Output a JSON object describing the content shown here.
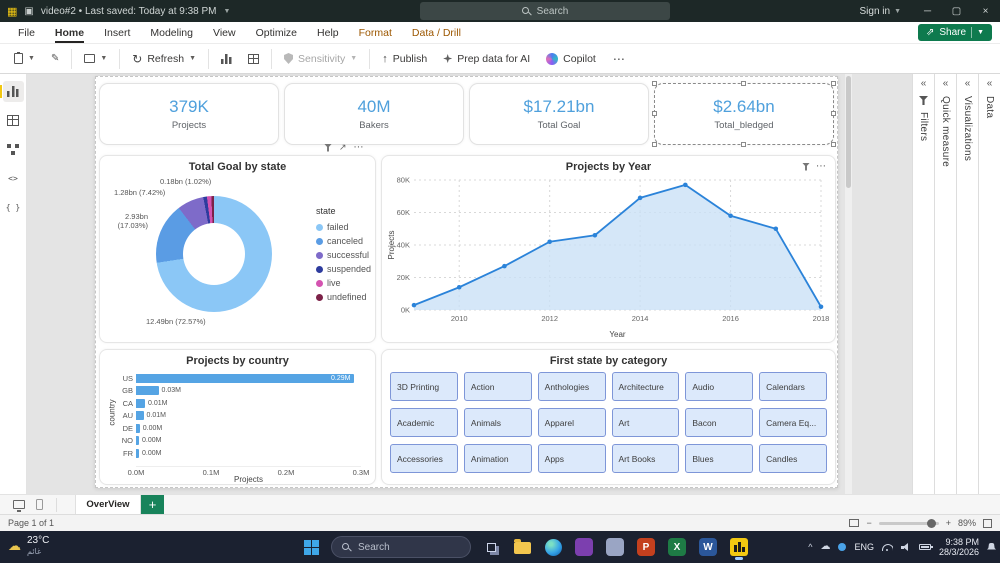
{
  "titlebar": {
    "app_title": "video#2 • Last saved: Today at 9:38 PM",
    "search_placeholder": "Search",
    "sign_in_label": "Sign in"
  },
  "menubar": {
    "tabs": [
      "File",
      "Home",
      "Insert",
      "Modeling",
      "View",
      "Optimize",
      "Help",
      "Format",
      "Data / Drill"
    ],
    "active_tab": "Home",
    "contextual_tabs": [
      "Format",
      "Data / Drill"
    ],
    "share_label": "Share"
  },
  "ribbon": {
    "refresh_label": "Refresh",
    "sensitivity_label": "Sensitivity",
    "publish_label": "Publish",
    "prep_data_ai_label": "Prep data for AI",
    "copilot_label": "Copilot",
    "more_label": "⋯"
  },
  "view_rail": [
    {
      "name": "report-view",
      "selected": true
    },
    {
      "name": "table-view",
      "selected": false
    },
    {
      "name": "model-view",
      "selected": false
    },
    {
      "name": "dax-query-view",
      "selected": false
    },
    {
      "name": "tmdl-view",
      "selected": false
    }
  ],
  "kpi_cards": [
    {
      "value": "379K",
      "label": "Projects",
      "selected": false
    },
    {
      "value": "40M",
      "label": "Bakers",
      "selected": false
    },
    {
      "value": "$17.21bn",
      "label": "Total Goal",
      "selected": false
    },
    {
      "value": "$2.64bn",
      "label": "Total_bledged",
      "selected": true
    }
  ],
  "chart_data": [
    {
      "id": "donut",
      "type": "pie",
      "title": "Total Goal by state",
      "legend_title": "state",
      "legend_position": "right",
      "categories": [
        "failed",
        "canceled",
        "successful",
        "suspended",
        "live",
        "undefined"
      ],
      "values_bn": [
        12.49,
        2.93,
        1.28,
        0.18,
        0.21,
        0.12
      ],
      "percentages": [
        72.57,
        17.03,
        7.42,
        1.02,
        1.21,
        0.75
      ],
      "colors": [
        "#8BC7F6",
        "#5A9CE4",
        "#7E6BC9",
        "#2E3C9E",
        "#D453B0",
        "#7C2248"
      ],
      "data_labels": [
        "12.49bn (72.57%)",
        "2.93bn (17.03%)",
        "1.28bn (7.42%)",
        "0.18bn (1.02%)"
      ]
    },
    {
      "id": "line",
      "type": "line",
      "title": "Projects by Year",
      "xlabel": "Year",
      "ylabel": "Projects",
      "x": [
        2009,
        2010,
        2011,
        2012,
        2013,
        2014,
        2015,
        2016,
        2017,
        2018
      ],
      "values_k": [
        3,
        14,
        27,
        42,
        46,
        69,
        77,
        58,
        50,
        2
      ],
      "ylim": [
        0,
        80
      ],
      "y_ticks": [
        "0K",
        "20K",
        "40K",
        "60K",
        "80K"
      ],
      "x_ticks": [
        2010,
        2012,
        2014,
        2016,
        2018
      ],
      "grid": true,
      "line_color": "#2B83D9",
      "fill_color": "#C9E0F6"
    },
    {
      "id": "bars",
      "type": "bar",
      "title": "Projects by country",
      "xlabel": "Projects",
      "ylabel": "country",
      "categories": [
        "US",
        "GB",
        "CA",
        "AU",
        "DE",
        "NO",
        "FR"
      ],
      "values_m": [
        0.29,
        0.03,
        0.012,
        0.01,
        0.005,
        0.004,
        0.004
      ],
      "labels": [
        "0.29M",
        "0.03M",
        "0.01M",
        "0.01M",
        "0.00M",
        "0.00M",
        "0.00M"
      ],
      "xlim": [
        0,
        0.3
      ],
      "x_ticks": [
        "0.0M",
        "0.1M",
        "0.2M",
        "0.3M"
      ],
      "bar_color": "#55A4E4"
    }
  ],
  "category_tiles": {
    "title": "First state by category",
    "tile_bg": "#DCE9FB",
    "tile_border": "#7E96D8",
    "buttons": [
      "3D Printing",
      "Action",
      "Anthologies",
      "Architecture",
      "Audio",
      "Calendars",
      "Academic",
      "Animals",
      "Apparel",
      "Art",
      "Bacon",
      "Camera Eq...",
      "Accessories",
      "Animation",
      "Apps",
      "Art Books",
      "Blues",
      "Candles"
    ]
  },
  "right_panes": [
    {
      "label": "Filters",
      "icon": "filter-funnel"
    },
    {
      "label": "Quick measure"
    },
    {
      "label": "Visualizations"
    },
    {
      "label": "Data"
    }
  ],
  "page_nav": {
    "active_tab": "OverView",
    "add_page": "+"
  },
  "statusbar": {
    "page_status": "Page 1 of 1",
    "zoom": "89%"
  },
  "taskbar": {
    "weather": {
      "temp": "23°C",
      "condition": "غائم"
    },
    "search_placeholder": "Search",
    "app_icons": [
      {
        "name": "task-view",
        "color": "#8D99BC"
      },
      {
        "name": "file-explorer",
        "color": "#F3C64E"
      },
      {
        "name": "edge-browser",
        "color": "#35A3E8"
      },
      {
        "name": "visual-studio",
        "color": "#7C3FAF"
      },
      {
        "name": "microsoft-store",
        "color": "#9AA5C4"
      },
      {
        "name": "powerpoint",
        "color": "#C4401E",
        "letter": "P"
      },
      {
        "name": "excel",
        "color": "#1E7B45",
        "letter": "X"
      },
      {
        "name": "word",
        "color": "#2B579A",
        "letter": "W"
      },
      {
        "name": "power-bi",
        "color": "#F2C811",
        "active": true
      }
    ],
    "tray": {
      "language": "ENG",
      "time": "9:38 PM",
      "date": "28/3/2026"
    }
  },
  "colors": {
    "kpi_value": "#4FA0DC",
    "accent_green": "#0E7A4E",
    "contextual_tab": "#9C5700",
    "taskbar_bg": "#1B2130"
  }
}
